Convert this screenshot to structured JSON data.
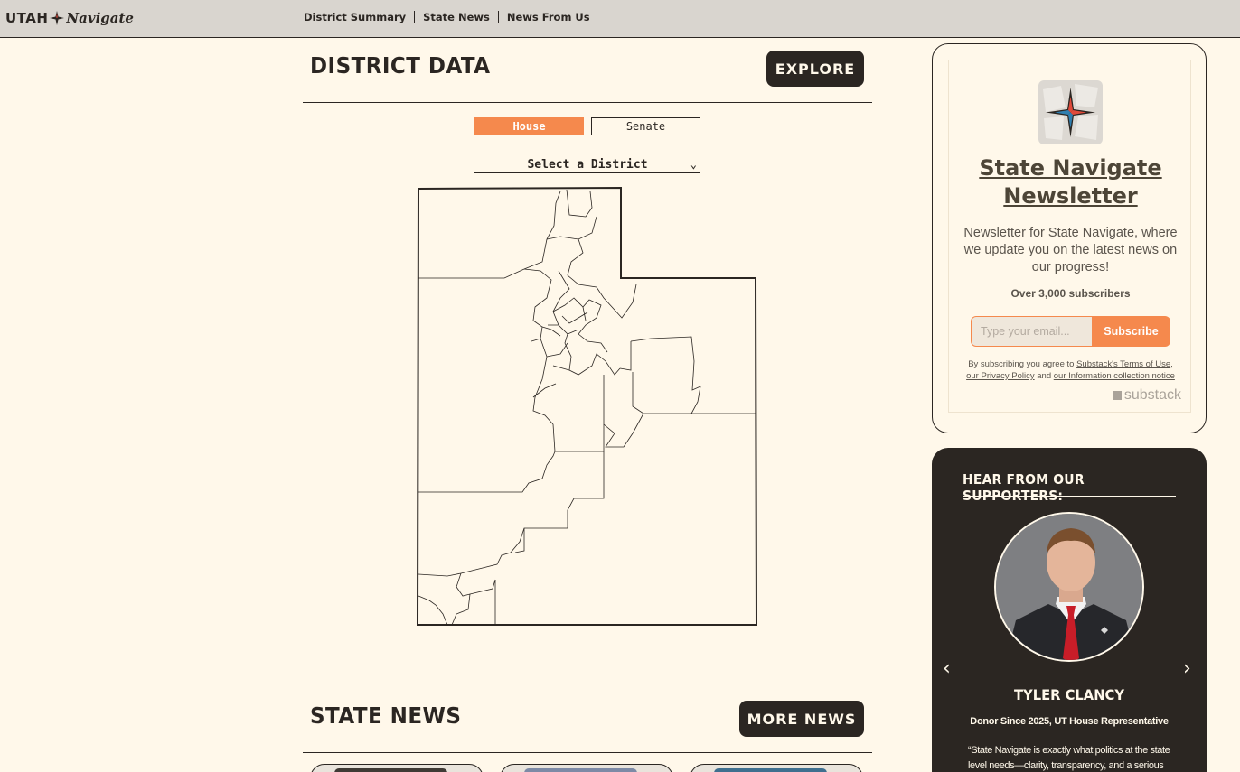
{
  "logo": {
    "utah": "UTAH",
    "navigate": "Navigate"
  },
  "nav": {
    "items": [
      {
        "label": "District Summary"
      },
      {
        "label": "State News"
      },
      {
        "label": "News From Us"
      }
    ]
  },
  "district": {
    "title": "DISTRICT DATA",
    "explore_label": "EXPLORE",
    "tabs": [
      {
        "label": "House",
        "active": true
      },
      {
        "label": "Senate",
        "active": false
      }
    ],
    "select_value": "Select a District",
    "colors": {
      "accent": "#f5894d",
      "dark": "#2b2622",
      "background": "#fff8ea"
    }
  },
  "news": {
    "title": "STATE NEWS",
    "more_label": "MORE NEWS"
  },
  "newsletter": {
    "title": "State Navigate Newsletter",
    "description": "Newsletter for State Navigate, where we update you on the latest news on our progress!",
    "subscriber_count": "Over 3,000 subscribers",
    "email_placeholder": "Type your email...",
    "subscribe_label": "Subscribe",
    "terms_prefix": "By subscribing you agree to",
    "terms_link": "Substack's Terms of Use",
    "privacy_link": "our Privacy Policy",
    "terms_and": "and",
    "info_link": "our Information collection notice",
    "brand": "substack"
  },
  "supporters": {
    "title": "HEAR FROM OUR SUPPORTERS:",
    "name": "TYLER CLANCY",
    "role": "Donor Since 2025, UT House Representative",
    "quote": "“State Navigate is exactly what politics at the state level needs—clarity, transparency, and a serious",
    "prev_icon": "chevron-left-icon",
    "next_icon": "chevron-right-icon"
  }
}
